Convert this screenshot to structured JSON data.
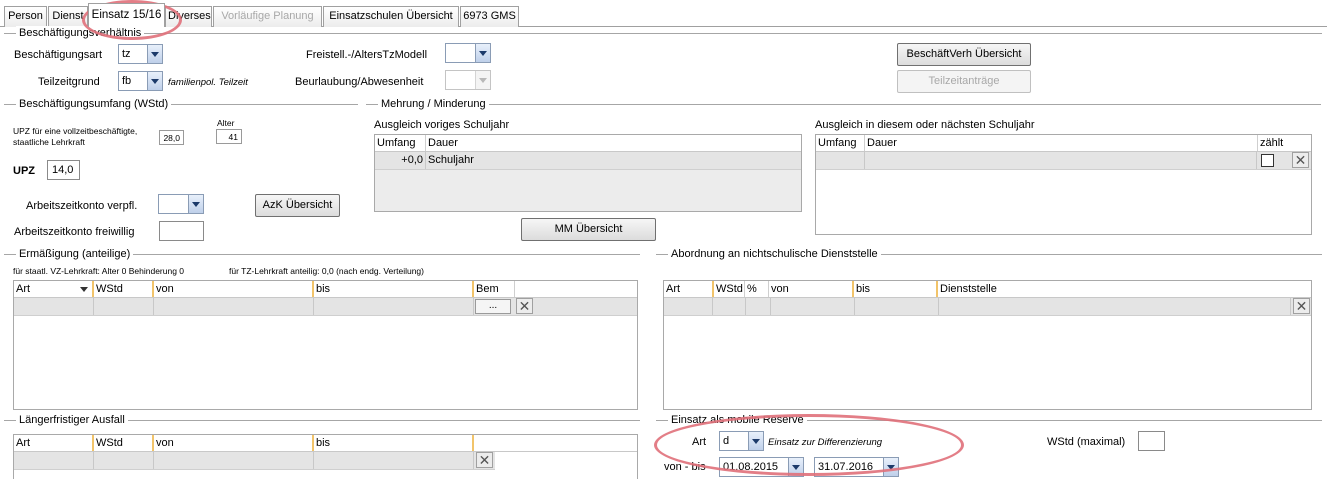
{
  "tabs": [
    {
      "label": "Person",
      "state": "normal"
    },
    {
      "label": "Dienst",
      "state": "normal"
    },
    {
      "label": "Einsatz 15/16",
      "state": "active"
    },
    {
      "label": "Diverses",
      "state": "normal"
    },
    {
      "label": "Vorläufige Planung",
      "state": "disabled"
    },
    {
      "label": "Einsatzschulen Übersicht",
      "state": "normal"
    },
    {
      "label": "6973 GMS",
      "state": "normal"
    }
  ],
  "beschaeftigung": {
    "title": "Beschäftigungsverhältnis",
    "art_label": "Beschäftigungsart",
    "art_value": "tz",
    "teilzeitgrund_label": "Teilzeitgrund",
    "teilzeitgrund_value": "fb",
    "teilzeitgrund_desc": "familienpol. Teilzeit",
    "freistell_label": "Freistell.-/AltersTzModell",
    "freistell_value": "",
    "beurlaubung_label": "Beurlaubung/Abwesenheit",
    "beurlaubung_value": "",
    "btn_overview": "BeschäftVerh Übersicht",
    "btn_teilzeit": "Teilzeitanträge"
  },
  "umfang": {
    "title": "Beschäftigungsumfang (WStd)",
    "upz_desc_line1": "UPZ für eine vollzeitbeschäftigte,",
    "upz_desc_line2": "staatliche Lehrkraft",
    "upz_full": "28,0",
    "alter_label": "Alter",
    "alter_value": "41",
    "upz_label": "UPZ",
    "upz_value": "14,0",
    "azk_verpfl_label": "Arbeitszeitkonto verpfl.",
    "azk_verpfl_value": "",
    "azk_freiw_label": "Arbeitszeitkonto freiwillig",
    "azk_freiw_value": "",
    "btn_azk": "AzK Übersicht"
  },
  "mehrung": {
    "title": "Mehrung / Minderung",
    "prev_title": "Ausgleich voriges Schuljahr",
    "prev_columns": [
      "Umfang",
      "Dauer"
    ],
    "prev_rows": [
      {
        "umfang": "+0,0",
        "dauer": "Schuljahr"
      }
    ],
    "next_title": "Ausgleich in diesem oder nächsten Schuljahr",
    "next_columns": [
      "Umfang",
      "Dauer",
      "zählt"
    ],
    "btn_mm": "MM Übersicht"
  },
  "ermaessigung": {
    "title": "Ermäßigung (anteilige)",
    "note_left": "für staatl. VZ-Lehrkraft: Alter 0 Behinderung 0",
    "note_right": "für TZ-Lehrkraft anteilig: 0,0 (nach endg. Verteilung)",
    "columns": [
      "Art",
      "WStd",
      "von",
      "bis",
      "Bem"
    ],
    "dots": "..."
  },
  "abordnung": {
    "title": "Abordnung an nichtschulische Dienststelle",
    "columns": [
      "Art",
      "WStd",
      "%",
      "von",
      "bis",
      "Dienststelle"
    ]
  },
  "ausfall": {
    "title": "Längerfristiger Ausfall",
    "columns": [
      "Art",
      "WStd",
      "von",
      "bis"
    ]
  },
  "reserve": {
    "title": "Einsatz als mobile Reserve",
    "art_label": "Art",
    "art_value": "d",
    "art_desc": "Einsatz zur Differenzierung",
    "wstd_label": "WStd (maximal)",
    "wstd_value": "",
    "vonbis_label": "von - bis",
    "von_value": "01.08.2015",
    "bis_value": "31.07.2016"
  },
  "icons": {
    "delete": "delete-x-icon",
    "dropdown": "chevron-down-icon"
  },
  "colors": {
    "highlight": "#e0707a",
    "column_separator": "#f2c46a",
    "grid_row": "#e4e4e4"
  }
}
